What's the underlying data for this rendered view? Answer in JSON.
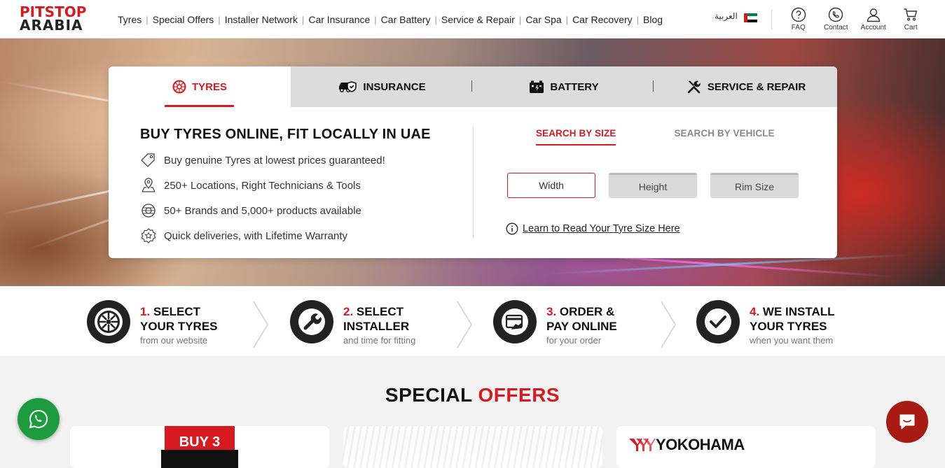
{
  "header": {
    "logo_top": "PITSTOP",
    "logo_bottom": "ARABIA",
    "nav": [
      "Tyres",
      "Special Offers",
      "Installer Network",
      "Car Insurance",
      "Car Battery",
      "Service & Repair",
      "Car Spa",
      "Car Recovery",
      "Blog"
    ],
    "language": "العربية",
    "icons": [
      {
        "label": "FAQ",
        "icon": "question-icon"
      },
      {
        "label": "Contact",
        "icon": "phone-icon"
      },
      {
        "label": "Account",
        "icon": "user-icon"
      },
      {
        "label": "Cart",
        "icon": "cart-icon"
      }
    ]
  },
  "card": {
    "tabs": [
      {
        "label": "TYRES",
        "icon": "tyre-icon",
        "active": true
      },
      {
        "label": "INSURANCE",
        "icon": "car-shield-icon",
        "active": false
      },
      {
        "label": "BATTERY",
        "icon": "battery-icon",
        "active": false
      },
      {
        "label": "SERVICE & REPAIR",
        "icon": "tools-icon",
        "active": false
      }
    ],
    "headline": "BUY TYRES ONLINE, FIT LOCALLY IN UAE",
    "features": [
      "Buy genuine Tyres at lowest prices guaranteed!",
      "250+ Locations, Right Technicians & Tools",
      "50+ Brands and 5,000+ products available",
      "Quick deliveries, with Lifetime Warranty"
    ],
    "search_tabs": [
      "SEARCH BY SIZE",
      "SEARCH BY VEHICLE"
    ],
    "fields": [
      "Width",
      "Height",
      "Rim Size"
    ],
    "learn_link": "Learn to Read Your Tyre Size Here"
  },
  "steps": [
    {
      "num": "1.",
      "line1": "SELECT",
      "line2": "YOUR TYRES",
      "sub": "from our website"
    },
    {
      "num": "2.",
      "line1": "SELECT",
      "line2": "INSTALLER",
      "sub": "and time for fitting"
    },
    {
      "num": "3.",
      "line1": "ORDER &",
      "line2": "PAY ONLINE",
      "sub": "for your order"
    },
    {
      "num": "4.",
      "line1": "WE INSTALL",
      "line2": "YOUR TYRES",
      "sub": "when you want them"
    }
  ],
  "offers": {
    "title_black": "SPECIAL",
    "title_red": "OFFERS",
    "badge": "BUY 3",
    "brand": "YOKOHAMA"
  },
  "colors": {
    "brand_red": "#d71920",
    "whatsapp": "#1d9c3f",
    "chat": "#a81b13"
  }
}
